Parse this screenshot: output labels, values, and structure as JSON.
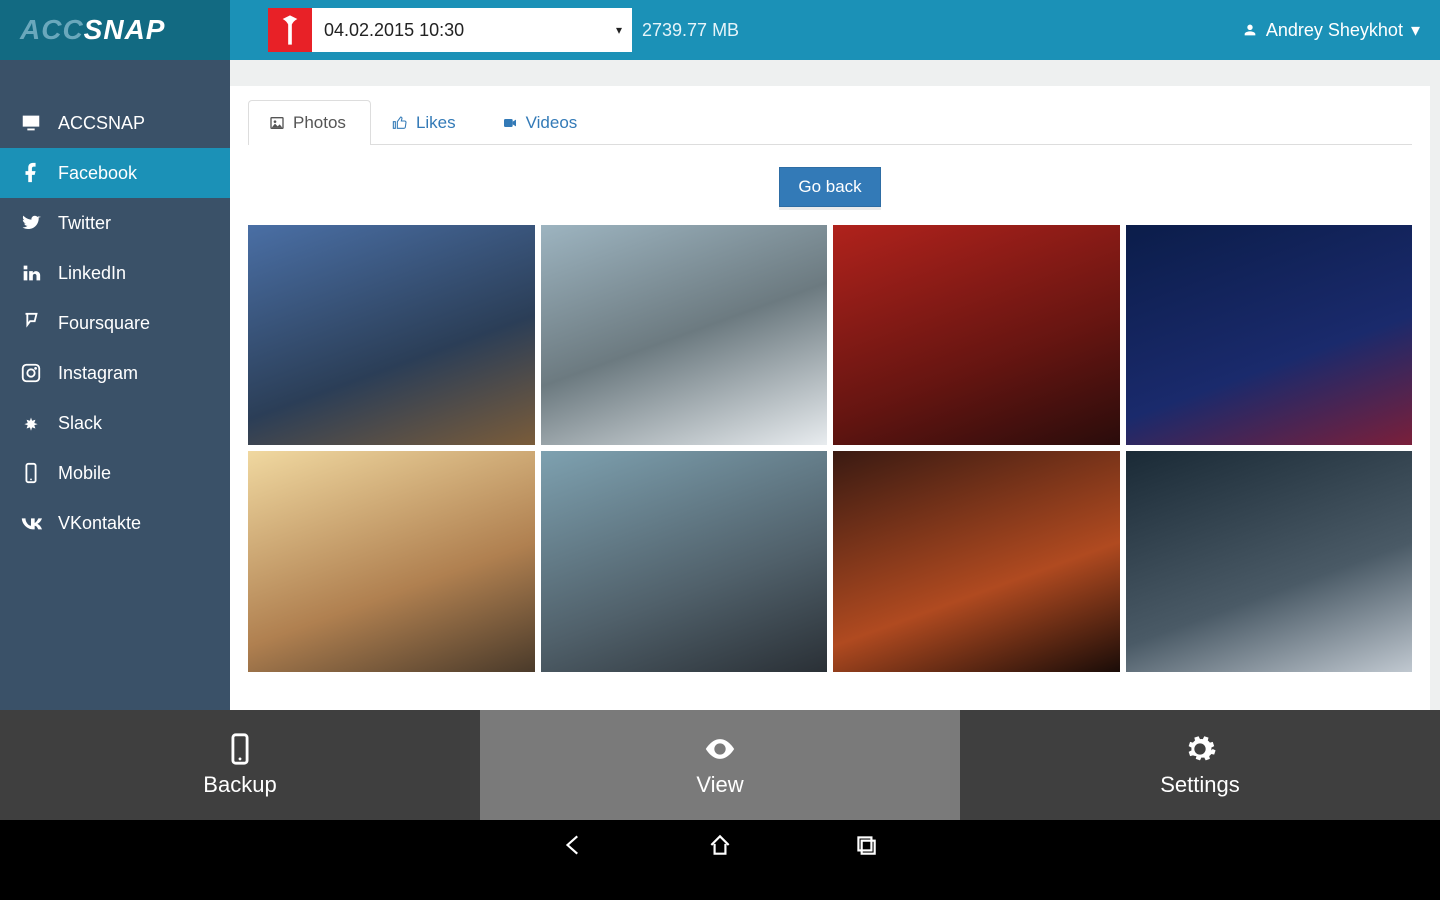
{
  "app_name": {
    "part1": "ACC",
    "part2": "SNAP"
  },
  "header": {
    "date_value": "04.02.2015 10:30",
    "storage": "2739.77 MB",
    "user_name": "Andrey Sheykhot"
  },
  "sidebar": {
    "items": [
      {
        "label": "ACCSNAP",
        "icon": "monitor-icon"
      },
      {
        "label": "Facebook",
        "icon": "facebook-icon"
      },
      {
        "label": "Twitter",
        "icon": "twitter-icon"
      },
      {
        "label": "LinkedIn",
        "icon": "linkedin-icon"
      },
      {
        "label": "Foursquare",
        "icon": "foursquare-icon"
      },
      {
        "label": "Instagram",
        "icon": "instagram-icon"
      },
      {
        "label": "Slack",
        "icon": "slack-icon"
      },
      {
        "label": "Mobile",
        "icon": "mobile-icon"
      },
      {
        "label": "VKontakte",
        "icon": "vk-icon"
      }
    ],
    "active_index": 1
  },
  "tabs": {
    "items": [
      {
        "label": "Photos",
        "icon": "image-icon"
      },
      {
        "label": "Likes",
        "icon": "thumbs-up-icon"
      },
      {
        "label": "Videos",
        "icon": "video-icon"
      }
    ],
    "active_index": 0
  },
  "buttons": {
    "go_back": "Go back"
  },
  "bottom_nav": {
    "items": [
      {
        "label": "Backup",
        "icon": "phone-icon"
      },
      {
        "label": "View",
        "icon": "eye-icon"
      },
      {
        "label": "Settings",
        "icon": "gear-icon"
      }
    ],
    "active_index": 1
  }
}
